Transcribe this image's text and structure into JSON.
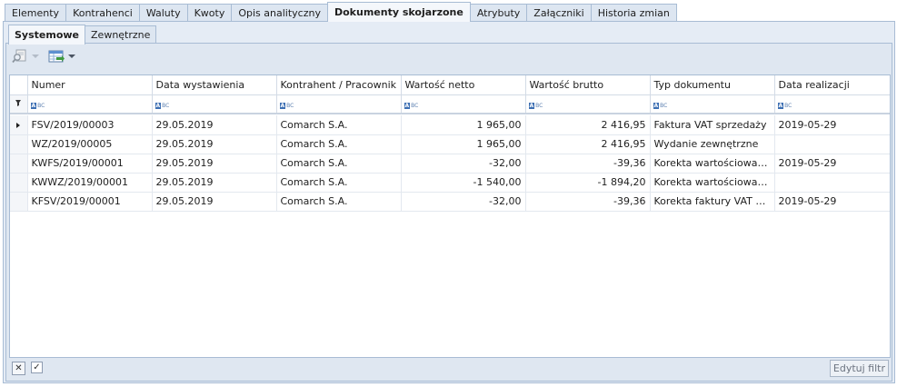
{
  "top_tabs": [
    {
      "label": "Elementy"
    },
    {
      "label": "Kontrahenci"
    },
    {
      "label": "Waluty"
    },
    {
      "label": "Kwoty"
    },
    {
      "label": "Opis analityczny"
    },
    {
      "label": "Dokumenty skojarzone",
      "active": true
    },
    {
      "label": "Atrybuty"
    },
    {
      "label": "Załączniki"
    },
    {
      "label": "Historia zmian"
    }
  ],
  "sub_tabs": [
    {
      "label": "Systemowe",
      "active": true
    },
    {
      "label": "Zewnętrzne"
    }
  ],
  "toolbar": {
    "preview_icon": "magnifier-document-icon",
    "export_icon": "grid-export-icon"
  },
  "grid": {
    "columns": [
      "Numer",
      "Data wystawienia",
      "Kontrahent / Pracownik",
      "Wartość netto",
      "Wartość brutto",
      "Typ dokumentu",
      "Data realizacji"
    ],
    "filter_placeholder": "ABC",
    "rows": [
      {
        "numer": "FSV/2019/00003",
        "data": "29.05.2019",
        "kontrahent": "Comarch S.A.",
        "netto": "1 965,00",
        "brutto": "2 416,95",
        "typ": "Faktura VAT sprzedaży",
        "realizacja": "2019-05-29",
        "selected": true
      },
      {
        "numer": "WZ/2019/00005",
        "data": "29.05.2019",
        "kontrahent": "Comarch S.A.",
        "netto": "1 965,00",
        "brutto": "2 416,95",
        "typ": "Wydanie zewnętrzne",
        "realizacja": ""
      },
      {
        "numer": "KWFS/2019/00001",
        "data": "29.05.2019",
        "kontrahent": "Comarch S.A.",
        "netto": "-32,00",
        "brutto": "-39,36",
        "typ": "Korekta wartościowa fa...",
        "realizacja": "2019-05-29"
      },
      {
        "numer": "KWWZ/2019/00001",
        "data": "29.05.2019",
        "kontrahent": "Comarch S.A.",
        "netto": "-1 540,00",
        "brutto": "-1 894,20",
        "typ": "Korekta wartościowa w...",
        "realizacja": ""
      },
      {
        "numer": "KFSV/2019/00001",
        "data": "29.05.2019",
        "kontrahent": "Comarch S.A.",
        "netto": "-32,00",
        "brutto": "-39,36",
        "typ": "Korekta faktury VAT spr...",
        "realizacja": "2019-05-29"
      }
    ]
  },
  "footer": {
    "clear_filter_symbol": "✕",
    "checkbox_symbol": "✓",
    "edit_filter_label": "Edytuj filtr"
  }
}
